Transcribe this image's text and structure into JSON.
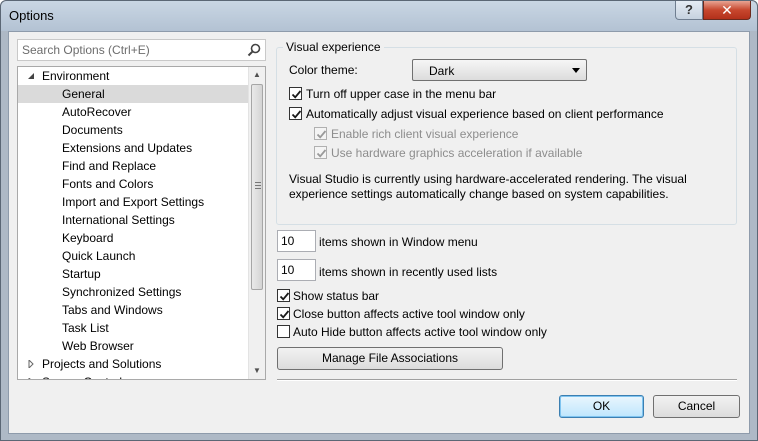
{
  "window": {
    "title": "Options",
    "help_label": "?",
    "close_label": "✕"
  },
  "search": {
    "placeholder": "Search Options (Ctrl+E)"
  },
  "tree": {
    "items": [
      {
        "label": "Environment",
        "level": 0,
        "expanded": true
      },
      {
        "label": "General",
        "level": 1,
        "selected": true
      },
      {
        "label": "AutoRecover",
        "level": 1
      },
      {
        "label": "Documents",
        "level": 1
      },
      {
        "label": "Extensions and Updates",
        "level": 1
      },
      {
        "label": "Find and Replace",
        "level": 1
      },
      {
        "label": "Fonts and Colors",
        "level": 1
      },
      {
        "label": "Import and Export Settings",
        "level": 1
      },
      {
        "label": "International Settings",
        "level": 1
      },
      {
        "label": "Keyboard",
        "level": 1
      },
      {
        "label": "Quick Launch",
        "level": 1
      },
      {
        "label": "Startup",
        "level": 1
      },
      {
        "label": "Synchronized Settings",
        "level": 1
      },
      {
        "label": "Tabs and Windows",
        "level": 1
      },
      {
        "label": "Task List",
        "level": 1
      },
      {
        "label": "Web Browser",
        "level": 1
      },
      {
        "label": "Projects and Solutions",
        "level": 0,
        "expanded": false
      },
      {
        "label": "Source Control",
        "level": 0,
        "expanded": false
      }
    ]
  },
  "visual": {
    "group_title": "Visual experience",
    "color_theme_label": "Color theme:",
    "color_theme_value": "Dark",
    "uppercase_menu_label": "Turn off upper case in the menu bar",
    "uppercase_menu_checked": true,
    "auto_adjust_label": "Automatically adjust visual experience based on client performance",
    "auto_adjust_checked": true,
    "rich_client_label": "Enable rich client visual experience",
    "rich_client_checked": true,
    "hw_accel_label": "Use hardware graphics acceleration if available",
    "hw_accel_checked": true,
    "info_line1": "Visual Studio is currently using hardware-accelerated rendering. The visual",
    "info_line2": "experience settings automatically change based on system capabilities."
  },
  "window_menu": {
    "value": "10",
    "label": "items shown in Window menu"
  },
  "recent_lists": {
    "value": "10",
    "label": "items shown in recently used lists"
  },
  "options": {
    "status_bar_label": "Show status bar",
    "status_bar_checked": true,
    "close_button_label": "Close button affects active tool window only",
    "close_button_checked": true,
    "auto_hide_label": "Auto Hide button affects active tool window only",
    "auto_hide_checked": false
  },
  "buttons": {
    "manage_file_assoc": "Manage File Associations",
    "ok": "OK",
    "cancel": "Cancel"
  }
}
